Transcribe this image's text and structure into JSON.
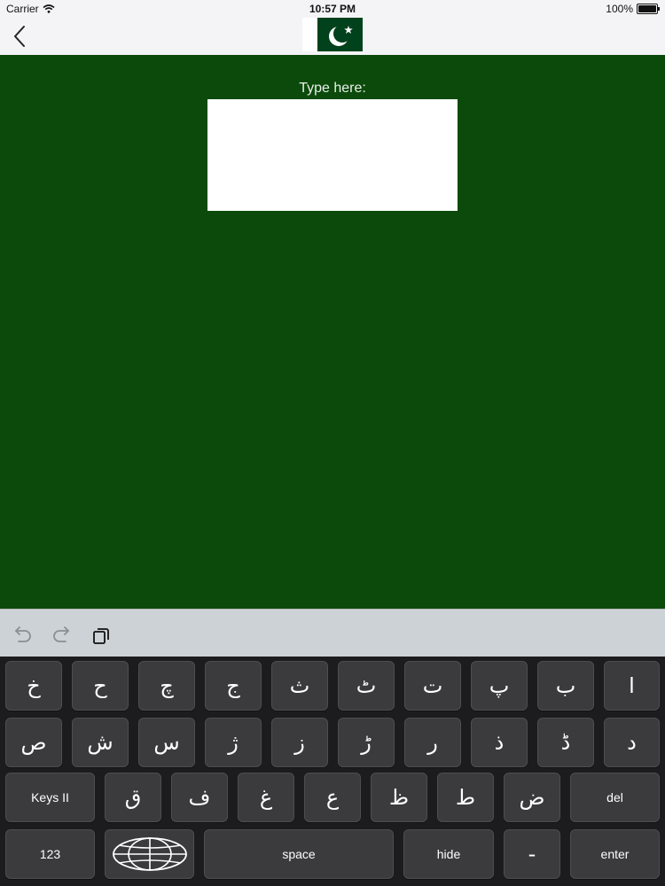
{
  "status_bar": {
    "carrier": "Carrier",
    "time": "10:57 PM",
    "battery": "100%"
  },
  "nav": {
    "back_icon": "chevron-left-icon",
    "flag_icon": "pakistan-flag-icon"
  },
  "main": {
    "type_label": "Type here:",
    "input_value": ""
  },
  "toolbar": {
    "undo_icon": "undo-icon",
    "redo_icon": "redo-icon",
    "paste_icon": "paste-icon"
  },
  "keyboard": {
    "row1": [
      "خ",
      "ح",
      "چ",
      "ج",
      "ث",
      "ٹ",
      "ت",
      "پ",
      "ب",
      "ا"
    ],
    "row2": [
      "ص",
      "ش",
      "س",
      "ژ",
      "ز",
      "ڑ",
      "ر",
      "ذ",
      "ڈ",
      "د"
    ],
    "row3": [
      "ق",
      "ف",
      "غ",
      "ع",
      "ظ",
      "ط",
      "ض"
    ],
    "keys_label": "Keys II",
    "del_label": "del",
    "numbers_label": "123",
    "globe_icon": "globe-icon",
    "space_label": "space",
    "hide_label": "hide",
    "dash_label": "-",
    "enter_label": "enter"
  },
  "colors": {
    "content_bg": "#0c4a0c",
    "keyboard_bg": "#1c1c1e",
    "key_bg": "#3b3b3d",
    "flag_green": "#01411c"
  }
}
